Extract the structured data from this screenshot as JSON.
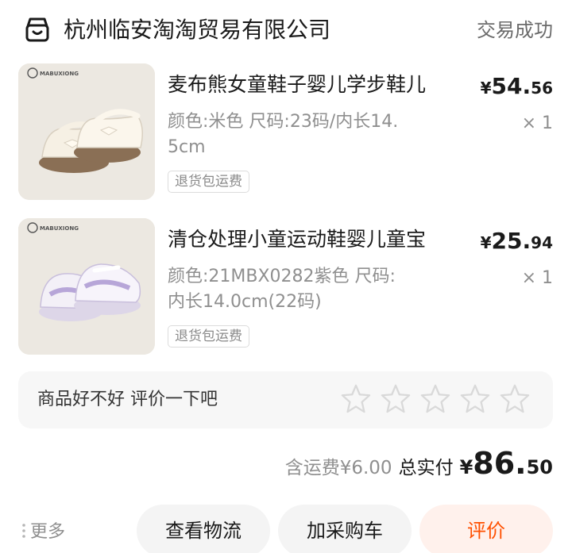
{
  "shop": {
    "name": "杭州临安淘淘贸易有限公司",
    "status": "交易成功"
  },
  "items": [
    {
      "title": "麦布熊女童鞋子婴儿学步鞋儿",
      "spec": "颜色:米色 尺码:23码/内长14.5cm",
      "price_yen": "¥",
      "price_int": "54.",
      "price_dec": "56",
      "qty": "× 1",
      "tag": "退货包运费",
      "brand": "MABUXIONG"
    },
    {
      "title": "清仓处理小童运动鞋婴儿童宝",
      "spec": "颜色:21MBX0282紫色 尺码:内长14.0cm(22码)",
      "price_yen": "¥",
      "price_int": "25.",
      "price_dec": "94",
      "qty": "× 1",
      "tag": "退货包运费",
      "brand": "MABUXIONG"
    }
  ],
  "review": {
    "prompt": "商品好不好 评价一下吧",
    "stars": 5,
    "rating": 0
  },
  "summary": {
    "shipping_note": "含运费¥6.00",
    "total_label": "总实付",
    "total_yen": "¥",
    "total_int": "86.",
    "total_dec": "50"
  },
  "footer": {
    "more_label": "更多",
    "logistics_label": "查看物流",
    "add_cart_label": "加采购车",
    "review_label": "评价"
  },
  "colors": {
    "accent": "#ff5000",
    "review_bg": "#fff1ec",
    "muted": "#8f8f8f",
    "star_stroke": "#d9d9d9"
  },
  "icons": {
    "shop": "shop-icon",
    "star": "star-outline-icon",
    "more": "more-dots-icon"
  }
}
